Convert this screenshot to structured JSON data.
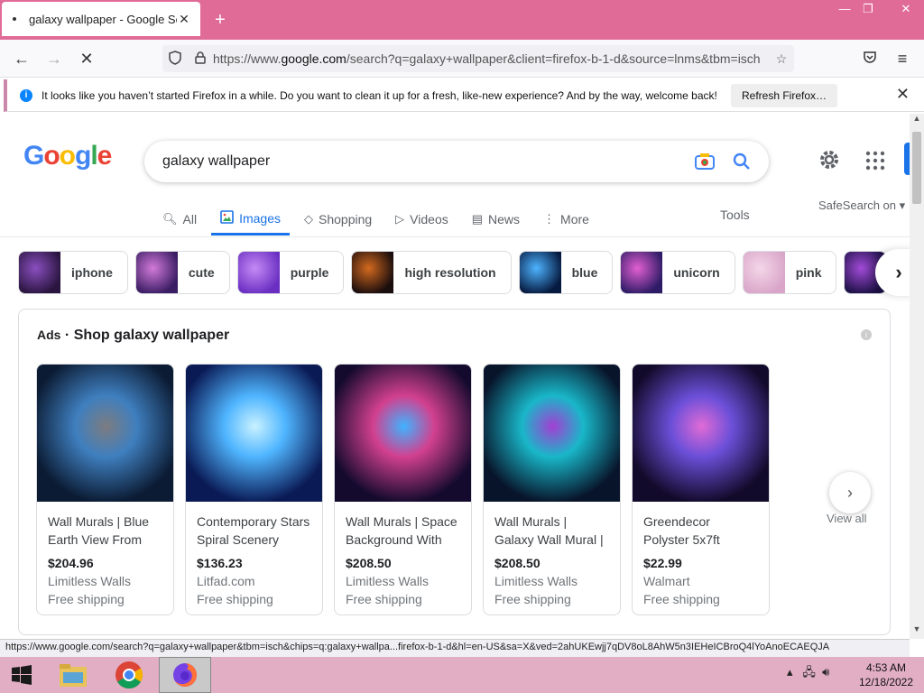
{
  "browser": {
    "tab_title": "galaxy wallpaper - Google Search",
    "url_prefix": "https://www.",
    "url_domain": "google.com",
    "url_rest": "/search?q=galaxy+wallpaper&client=firefox-b-1-d&source=lnms&tbm=isch",
    "new_tab_label": "+",
    "window_buttons": {
      "minimize": "—",
      "maximize": "❐",
      "close": "✕"
    }
  },
  "notification": {
    "message": "It looks like you haven’t started Firefox in a while. Do you want to clean it up for a fresh, like-new experience? And by the way, welcome back!",
    "button": "Refresh Firefox…",
    "close": "✕"
  },
  "google": {
    "logo": "Google",
    "query": "galaxy wallpaper",
    "tabs": [
      {
        "label": "All",
        "icon": "search-icon"
      },
      {
        "label": "Images",
        "icon": "image-icon",
        "active": true
      },
      {
        "label": "Shopping",
        "icon": "tag-icon"
      },
      {
        "label": "Videos",
        "icon": "play-icon"
      },
      {
        "label": "News",
        "icon": "newspaper-icon"
      },
      {
        "label": "More",
        "icon": "more-vert-icon"
      }
    ],
    "tools": "Tools",
    "safesearch": "SafeSearch on ▾",
    "chips": [
      {
        "label": "iphone",
        "colors": [
          "#2a1540",
          "#8a4fbf"
        ]
      },
      {
        "label": "cute",
        "colors": [
          "#3a1d63",
          "#d27ad9"
        ]
      },
      {
        "label": "purple",
        "colors": [
          "#6a2fc2",
          "#c58af5"
        ]
      },
      {
        "label": "high resolution",
        "colors": [
          "#1a0d0d",
          "#d2691e"
        ]
      },
      {
        "label": "blue",
        "colors": [
          "#061a40",
          "#4db3ff"
        ]
      },
      {
        "label": "unicorn",
        "colors": [
          "#2e1b66",
          "#e25fd0"
        ]
      },
      {
        "label": "pink",
        "colors": [
          "#d9a6c9",
          "#f4d6e8"
        ]
      },
      {
        "label": "",
        "colors": [
          "#1c1045",
          "#a24bd8"
        ]
      }
    ],
    "ads": {
      "tag": "Ads",
      "separator": "·",
      "title": "Shop galaxy wallpaper",
      "products": [
        {
          "title": "Wall Murals | Blue Earth View From",
          "price": "$204.96",
          "store": "Limitless Walls",
          "shipping": "Free shipping",
          "colors": [
            "#0b1b33",
            "#3f7fbf",
            "#7c7c80"
          ]
        },
        {
          "title": "Contemporary Stars Spiral Scenery",
          "price": "$136.23",
          "store": "Litfad.com",
          "shipping": "Free shipping",
          "colors": [
            "#0a1a55",
            "#4fb5ff",
            "#c9f1ff"
          ]
        },
        {
          "title": "Wall Murals | Space Background With",
          "price": "$208.50",
          "store": "Limitless Walls",
          "shipping": "Free shipping",
          "colors": [
            "#140a2e",
            "#d2408f",
            "#3fb3ff"
          ]
        },
        {
          "title": "Wall Murals | Galaxy Wall Mural |",
          "price": "$208.50",
          "store": "Limitless Walls",
          "shipping": "Free shipping",
          "colors": [
            "#08142a",
            "#19b7c9",
            "#a23fd2"
          ]
        },
        {
          "title": "Greendecor Polyster 5x7ft",
          "price": "$22.99",
          "store": "Walmart",
          "shipping": "Free shipping",
          "colors": [
            "#120a2a",
            "#6b4fd8",
            "#e06bd6"
          ]
        }
      ],
      "view_all": "View all"
    }
  },
  "status_url": "https://www.google.com/search?q=galaxy+wallpaper&tbm=isch&chips=q:galaxy+wallpa...firefox-b-1-d&hl=en-US&sa=X&ved=2ahUKEwjj7qDV8oL8AhW5n3IEHeICBroQ4lYoAnoECAEQJA",
  "taskbar": {
    "time": "4:53 AM",
    "date": "12/18/2022"
  },
  "colors": {
    "titlebar": "#e06b97",
    "taskbar": "#e1aec3",
    "google_blue": "#1a73e8"
  }
}
